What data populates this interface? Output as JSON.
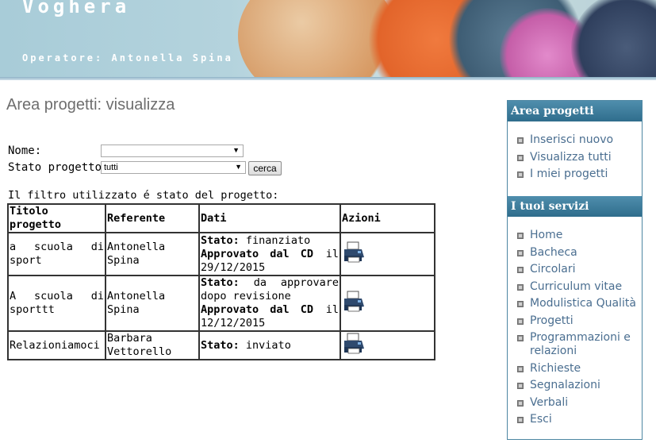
{
  "header": {
    "site_name": "Voghera",
    "operator_label": "Operatore: Antonella Spina"
  },
  "main": {
    "page_title": "Area progetti: visualizza",
    "form": {
      "name_label": "Nome:",
      "name_value": "",
      "status_label": "Stato progetto:",
      "status_value": "tutti",
      "search_button": "cerca"
    },
    "filter_text": "Il filtro utilizzato é stato del progetto:",
    "table": {
      "headers": [
        "Titolo progetto",
        "Referente",
        "Dati",
        "Azioni"
      ],
      "rows": [
        {
          "title": "a scuola di sport",
          "referent": "Antonella Spina",
          "status_label": "Stato:",
          "status_value": "finanziato",
          "approved_label": "Approvato dal CD",
          "approved_conj": "il",
          "approved_date": "29/12/2015"
        },
        {
          "title": "A scuola di sporttt",
          "referent": "Antonella Spina",
          "status_label": "Stato:",
          "status_value": "da approvare dopo revisione",
          "approved_label": "Approvato dal CD",
          "approved_conj": "il",
          "approved_date": "12/12/2015"
        },
        {
          "title": "Relazioniamoci",
          "referent": "Barbara Vettorello",
          "status_label": "Stato:",
          "status_value": "inviato"
        }
      ]
    }
  },
  "sidebar": {
    "area_title": "Area progetti",
    "area_items": [
      "Inserisci nuovo",
      "Visualizza tutti",
      "I miei progetti"
    ],
    "services_title": "I tuoi servizi",
    "services_items": [
      "Home",
      "Bacheca",
      "Circolari",
      "Curriculum vitae",
      "Modulistica Qualità",
      "Progetti",
      "Programmazioni e relazioni",
      "Richieste",
      "Segnalazioni",
      "Verbali",
      "Esci"
    ]
  },
  "icons": {
    "print": "printer-icon",
    "bullet": "square-bullet-icon"
  },
  "colors": {
    "panel_header": "#2f6d8c",
    "link": "#4a6e90",
    "title": "#6e6e6e"
  }
}
